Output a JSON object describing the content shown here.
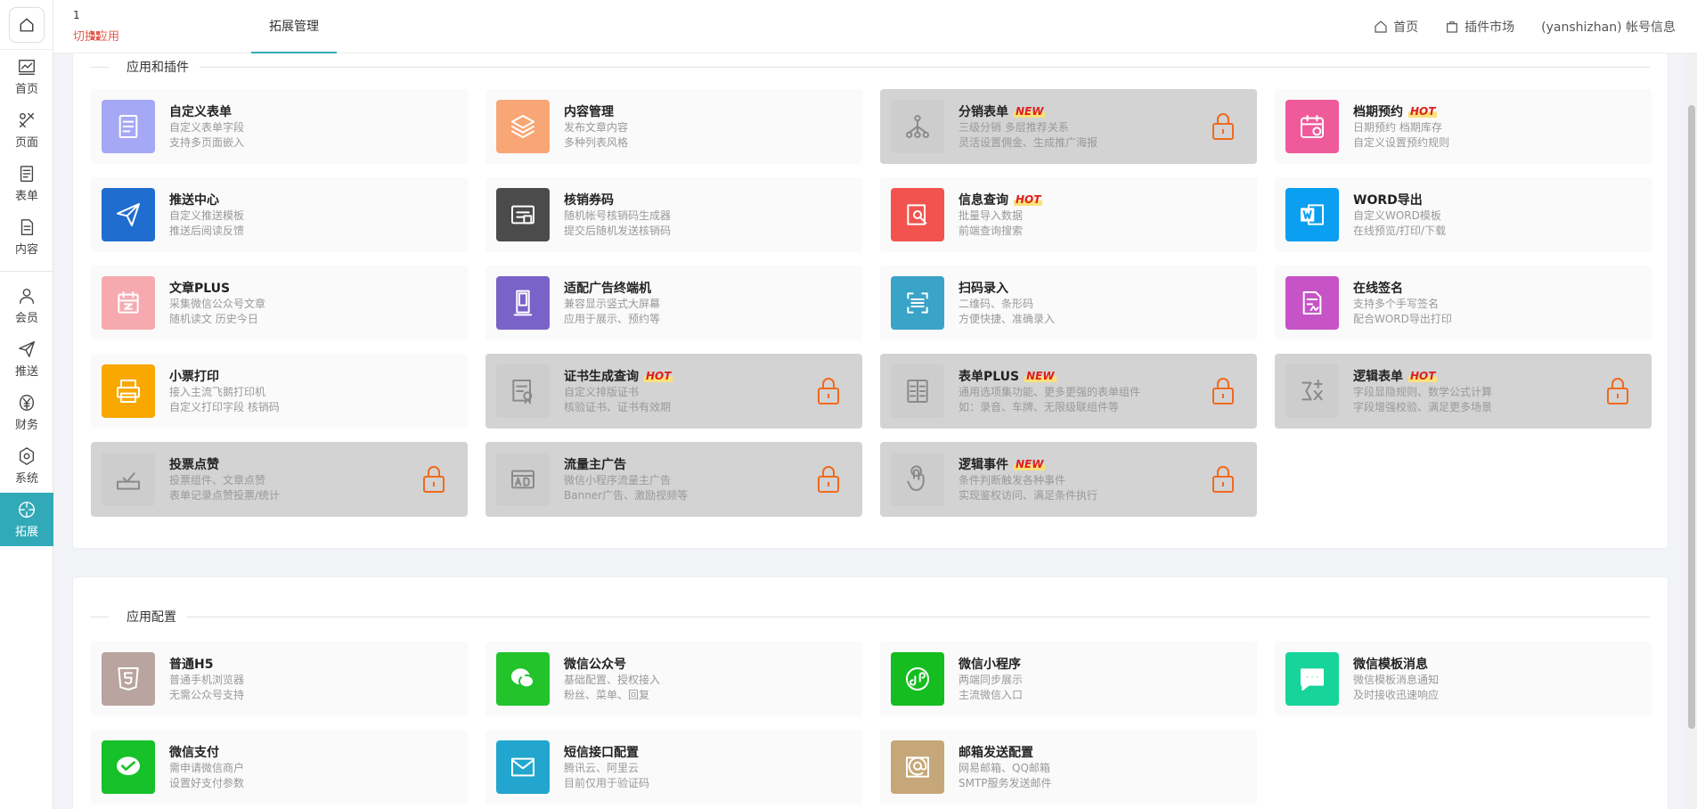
{
  "sidebar": {
    "items": [
      {
        "name": "dashboard",
        "icon": "chart-icon",
        "label": "首页"
      },
      {
        "name": "pages",
        "icon": "tools-icon",
        "label": "页面"
      },
      {
        "name": "forms",
        "icon": "form-icon",
        "label": "表单"
      },
      {
        "name": "content",
        "icon": "document-icon",
        "label": "内容"
      },
      {
        "name": "members",
        "icon": "user-icon",
        "label": "会员"
      },
      {
        "name": "push",
        "icon": "send-icon",
        "label": "推送"
      },
      {
        "name": "finance",
        "icon": "yen-icon",
        "label": "财务"
      },
      {
        "name": "system",
        "icon": "gear-icon",
        "label": "系统"
      },
      {
        "name": "extend",
        "icon": "extend-icon",
        "label": "拓展"
      }
    ]
  },
  "header": {
    "app_number": "1",
    "switch_app": "切换应用",
    "tab": "拓展管理",
    "home": "首页",
    "plugin_market": "插件市场",
    "account": "(yanshizhan) 帐号信息"
  },
  "apps_section": {
    "title": "应用和插件",
    "cards": [
      {
        "name": "自定义表单",
        "tag": "",
        "d1": "自定义表单字段",
        "d2": "支持多页面嵌入",
        "color": "#a5a8f5",
        "icon": "form-icon",
        "locked": false
      },
      {
        "name": "内容管理",
        "tag": "",
        "d1": "发布文章内容",
        "d2": "多种列表风格",
        "color": "#f8a676",
        "icon": "layers-icon",
        "locked": false
      },
      {
        "name": "分销表单",
        "tag": "NEW",
        "d1": "三级分销 多层推荐关系",
        "d2": "灵活设置佣金、生成推广海报",
        "color": "#cdcdcd",
        "icon": "network-icon",
        "locked": true
      },
      {
        "name": "档期预约",
        "tag": "HOT",
        "d1": "日期预约 档期库存",
        "d2": "自定义设置预约规则",
        "color": "#ef5a9a",
        "icon": "calendar-icon",
        "locked": false
      },
      {
        "name": "推送中心",
        "tag": "",
        "d1": "自定义推送模板",
        "d2": "推送后阅读反馈",
        "color": "#1f6ecf",
        "icon": "send-icon",
        "locked": false
      },
      {
        "name": "核销券码",
        "tag": "",
        "d1": "随机帐号核销码生成器",
        "d2": "提交后随机发送核销码",
        "color": "#4b4b4b",
        "icon": "ticket-icon",
        "locked": false
      },
      {
        "name": "信息查询",
        "tag": "HOT",
        "d1": "批量导入数据",
        "d2": "前端查询搜索",
        "color": "#f2534e",
        "icon": "search-doc-icon",
        "locked": false
      },
      {
        "name": "WORD导出",
        "tag": "",
        "d1": "自定义WORD模板",
        "d2": "在线预览/打印/下载",
        "color": "#0a9ff0",
        "icon": "word-icon",
        "locked": false
      },
      {
        "name": "文章PLUS",
        "tag": "",
        "d1": "采集微信公众号文章",
        "d2": "随机读文 历史今日",
        "color": "#f6aab0",
        "icon": "article-icon",
        "locked": false
      },
      {
        "name": "适配广告终端机",
        "tag": "",
        "d1": "兼容显示竖式大屏幕",
        "d2": "应用于展示、预约等",
        "color": "#7a62c8",
        "icon": "kiosk-icon",
        "locked": false
      },
      {
        "name": "扫码录入",
        "tag": "",
        "d1": "二维码、条形码",
        "d2": "方便快捷、准确录入",
        "color": "#3aa3c8",
        "icon": "scan-icon",
        "locked": false
      },
      {
        "name": "在线签名",
        "tag": "",
        "d1": "支持多个手写签名",
        "d2": "配合WORD导出打印",
        "color": "#c654c6",
        "icon": "sign-icon",
        "locked": false
      },
      {
        "name": "小票打印",
        "tag": "",
        "d1": "接入主流飞鹅打印机",
        "d2": "自定义打印字段 核销码",
        "color": "#f9a800",
        "icon": "printer-icon",
        "locked": false
      },
      {
        "name": "证书生成查询",
        "tag": "HOT",
        "d1": "自定义排版证书",
        "d2": "核验证书、证书有效期",
        "color": "#cdcdcd",
        "icon": "certificate-icon",
        "locked": true
      },
      {
        "name": "表单PLUS",
        "tag": "NEW",
        "d1": "通用选项集功能、更多更强的表单组件",
        "d2": "如：录音、车牌、无限级联组件等",
        "color": "#cdcdcd",
        "icon": "form-plus-icon",
        "locked": true
      },
      {
        "name": "逻辑表单",
        "tag": "HOT",
        "d1": "字段显隐规则、数学公式计算",
        "d2": "字段增强校验、满足更多场景",
        "color": "#cdcdcd",
        "icon": "formula-icon",
        "locked": true
      },
      {
        "name": "投票点赞",
        "tag": "",
        "d1": "投票组件、文章点赞",
        "d2": "表单记录点赞投票/统计",
        "color": "#cdcdcd",
        "icon": "vote-icon",
        "locked": true
      },
      {
        "name": "流量主广告",
        "tag": "",
        "d1": "微信小程序流量主广告",
        "d2": "Banner广告、激励视频等",
        "color": "#cdcdcd",
        "icon": "ad-icon",
        "locked": true
      },
      {
        "name": "逻辑事件",
        "tag": "NEW",
        "d1": "条件判断触发各种事件",
        "d2": "实现鉴权访问、满足条件执行",
        "color": "#cdcdcd",
        "icon": "touch-icon",
        "locked": true
      }
    ]
  },
  "config_section": {
    "title": "应用配置",
    "cards": [
      {
        "name": "普通H5",
        "tag": "",
        "d1": "普通手机浏览器",
        "d2": "无需公众号支持",
        "color": "#b9a4a0",
        "icon": "html5-icon",
        "locked": false
      },
      {
        "name": "微信公众号",
        "tag": "",
        "d1": "基础配置、授权接入",
        "d2": "粉丝、菜单、回复",
        "color": "#22c32b",
        "icon": "wechat-icon",
        "locked": false
      },
      {
        "name": "微信小程序",
        "tag": "",
        "d1": "两端同步展示",
        "d2": "主流微信入口",
        "color": "#15bd20",
        "icon": "miniprogram-icon",
        "locked": false
      },
      {
        "name": "微信模板消息",
        "tag": "",
        "d1": "微信模板消息通知",
        "d2": "及时接收迅速响应",
        "color": "#17d49b",
        "icon": "message-icon",
        "locked": false
      },
      {
        "name": "微信支付",
        "tag": "",
        "d1": "需申请微信商户",
        "d2": "设置好支付参数",
        "color": "#16c12a",
        "icon": "wechat-pay-icon",
        "locked": false
      },
      {
        "name": "短信接口配置",
        "tag": "",
        "d1": "腾讯云、阿里云",
        "d2": "目前仅用于验证码",
        "color": "#22a6cf",
        "icon": "mail-icon",
        "locked": false
      },
      {
        "name": "邮箱发送配置",
        "tag": "",
        "d1": "网易邮箱、QQ邮箱",
        "d2": "SMTP服务发送邮件",
        "color": "#c6a779",
        "icon": "email-icon",
        "locked": false
      }
    ]
  },
  "colors": {
    "accent": "#32a9b7",
    "lock": "#f06a1d",
    "tag": "#e0201b"
  }
}
